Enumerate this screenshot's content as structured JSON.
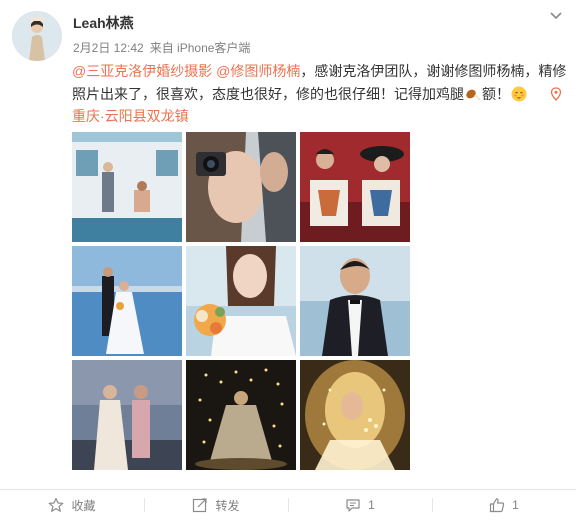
{
  "post": {
    "author": "Leah林燕",
    "meta": {
      "date": "2月2日 12:42",
      "source": "来自 iPhone客户端"
    },
    "text": {
      "mention1": "@三亚克洛伊婚纱摄影",
      "mention2": "@修图师杨楠",
      "body": "，感谢克洛伊团队，谢谢修图师杨楠，精修照片出来了，很喜欢，态度也很好，修的也很仔细！记得加鸡腿",
      "after_emoji": "额！"
    },
    "location": "重庆·云阳县双龙镇",
    "images": [
      {
        "icon": "photo-bus-couple"
      },
      {
        "icon": "photo-camera-portrait"
      },
      {
        "icon": "photo-couple-art"
      },
      {
        "icon": "photo-lake-couple"
      },
      {
        "icon": "photo-bride-bouquet"
      },
      {
        "icon": "photo-groom-suit"
      },
      {
        "icon": "photo-seaside-couple"
      },
      {
        "icon": "photo-night-lights"
      },
      {
        "icon": "photo-veil-lights"
      }
    ]
  },
  "actions": {
    "favorite": "收藏",
    "repost": "转发",
    "comment_count": "1",
    "like_count": "1"
  },
  "colors": {
    "mention": "#eb7350",
    "meta_text": "#808080",
    "body_text": "#333333"
  }
}
